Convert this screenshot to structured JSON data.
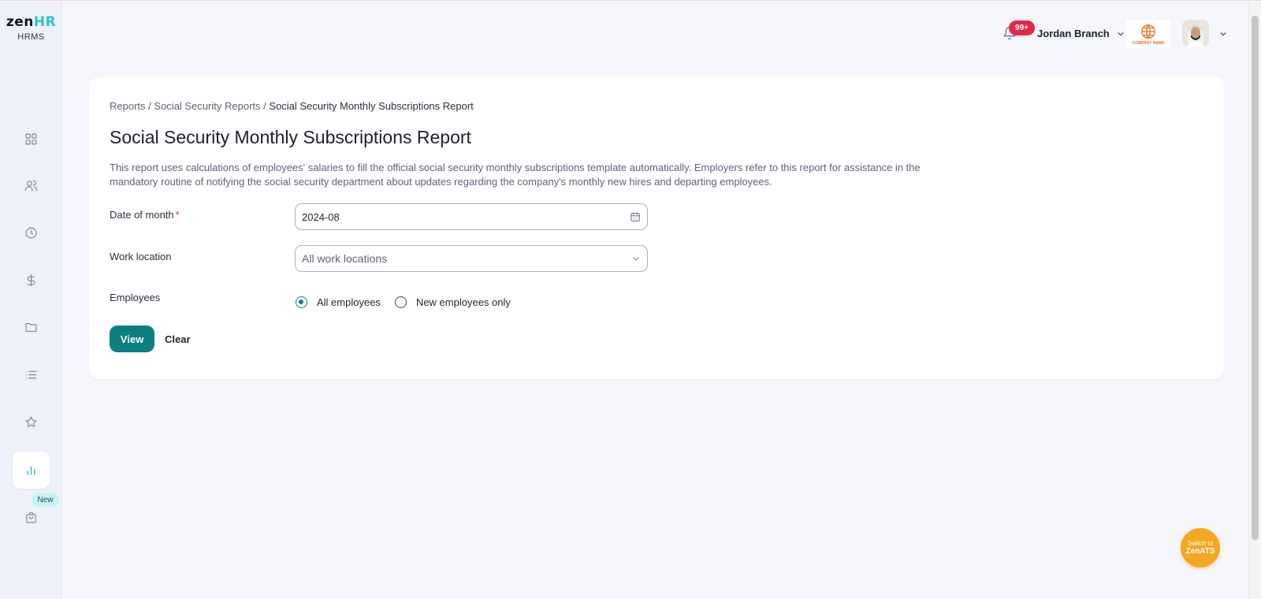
{
  "logo": {
    "word_a": "zen",
    "word_b": "HR",
    "subtitle": "HRMS"
  },
  "sidebar": {
    "items": [
      {
        "icon": "grid-icon"
      },
      {
        "icon": "users-icon"
      },
      {
        "icon": "clock-icon"
      },
      {
        "icon": "dollar-icon"
      },
      {
        "icon": "folder-icon"
      },
      {
        "icon": "list-icon"
      },
      {
        "icon": "star-icon"
      },
      {
        "icon": "bar-chart-icon",
        "active": true
      },
      {
        "icon": "shopping-bag-icon"
      }
    ],
    "new_badge": "New"
  },
  "header": {
    "notification_count": "99+",
    "branch": "Jordan Branch",
    "company_logo_text": "COMPANY NAME"
  },
  "breadcrumb": {
    "items": [
      "Reports",
      "Social Security Reports",
      "Social Security Monthly Subscriptions Report"
    ],
    "separator": "/"
  },
  "page": {
    "title": "Social Security Monthly Subscriptions Report",
    "description": "This report uses calculations of employees' salaries to fill the official social security monthly subscriptions template automatically. Employers refer to this report for assistance in the mandatory routine of notifying the social security department about updates regarding the company's monthly new hires and departing employees."
  },
  "form": {
    "date_label": "Date of month",
    "date_required": "*",
    "date_value": "2024-08",
    "location_label": "Work location",
    "location_placeholder": "All work locations",
    "employees_label": "Employees",
    "employees_options": [
      {
        "label": "All employees",
        "checked": true
      },
      {
        "label": "New employees only",
        "checked": false
      }
    ],
    "view_label": "View",
    "clear_label": "Clear"
  },
  "switch_button": {
    "line1": "Switch to",
    "line2": "ZenATS"
  },
  "colors": {
    "accent": "#0d7f80",
    "badge": "#e5264a",
    "switch": "#f5a623",
    "sidebar_active": "#1aa8b1"
  }
}
